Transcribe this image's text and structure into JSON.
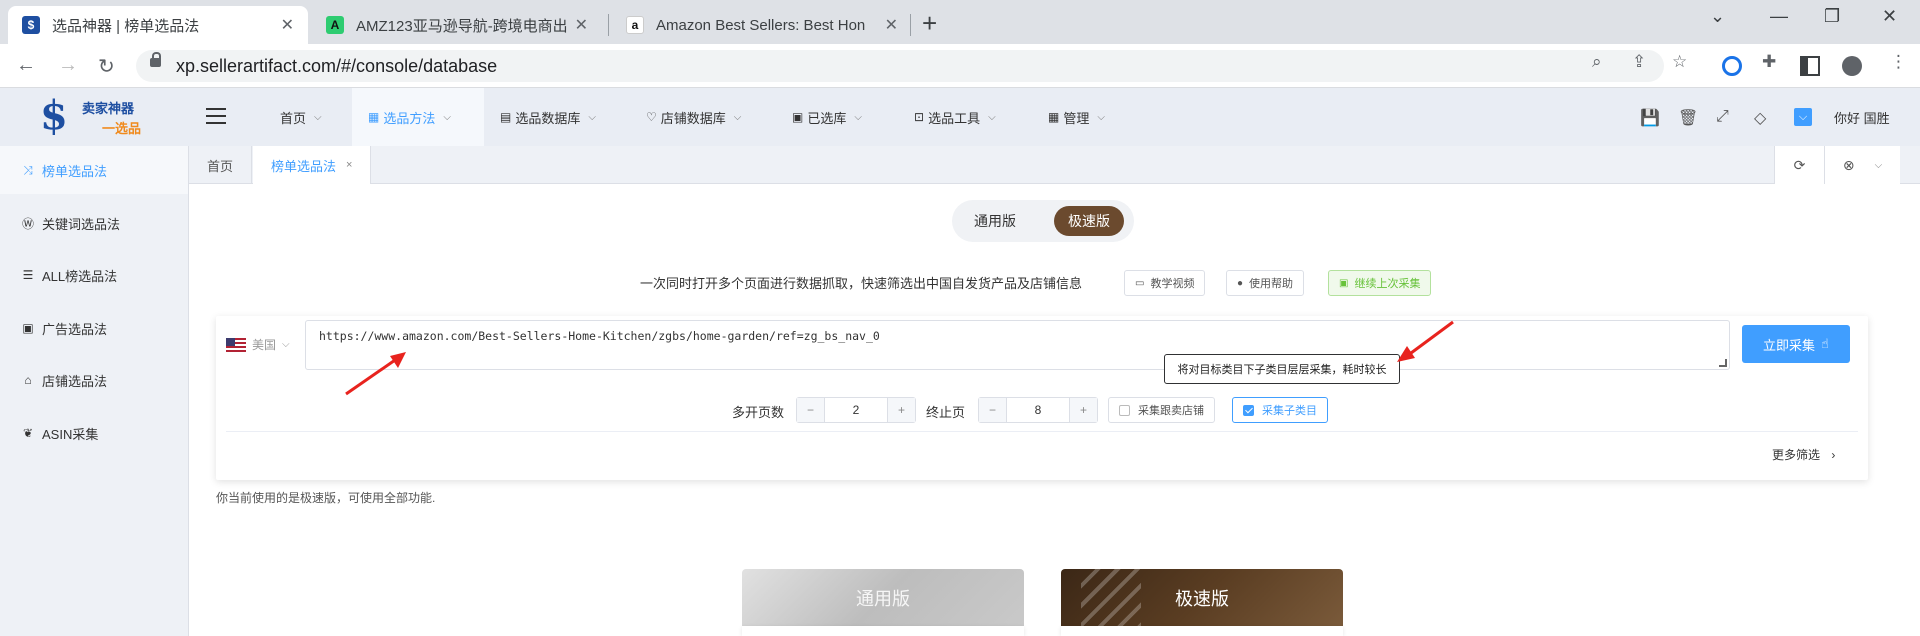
{
  "browser": {
    "tabs": [
      {
        "title": "选品神器 | 榜单选品法",
        "favicon": "sellerartifact-icon",
        "active": true
      },
      {
        "title": "AMZ123亚马逊导航-跨境电商出",
        "favicon": "amz123-icon",
        "active": false
      },
      {
        "title": "Amazon Best Sellers: Best Hon",
        "favicon": "amazon-icon",
        "active": false
      }
    ],
    "new_tab": "+",
    "url": "xp.sellerartifact.com/#/console/database"
  },
  "app": {
    "logo": {
      "line1": "卖家神器",
      "line2": "一选品"
    },
    "menu": [
      {
        "label": "首页",
        "icon": "",
        "active": false
      },
      {
        "label": "选品方法",
        "icon": "table-icon",
        "active": true
      },
      {
        "label": "选品数据库",
        "icon": "database-icon",
        "active": false
      },
      {
        "label": "店铺数据库",
        "icon": "heart-icon",
        "active": false
      },
      {
        "label": "已选库",
        "icon": "calendar-icon",
        "active": false
      },
      {
        "label": "选品工具",
        "icon": "tools-icon",
        "active": false
      },
      {
        "label": "管理",
        "icon": "grid-icon",
        "active": false
      }
    ],
    "greeting": "你好 国胜",
    "sidebar": [
      {
        "label": "榜单选品法",
        "icon": "shuffle-icon",
        "active": true
      },
      {
        "label": "关键词选品法",
        "icon": "wordpress-icon",
        "active": false
      },
      {
        "label": "ALL榜选品法",
        "icon": "list-icon",
        "active": false
      },
      {
        "label": "广告选品法",
        "icon": "ad-icon",
        "active": false
      },
      {
        "label": "店铺选品法",
        "icon": "shop-icon",
        "active": false
      },
      {
        "label": "ASIN采集",
        "icon": "leaf-icon",
        "active": false
      }
    ],
    "page_tabs": [
      {
        "label": "首页",
        "active": false
      },
      {
        "label": "榜单选品法",
        "active": true,
        "close": "×"
      }
    ]
  },
  "main": {
    "version_toggle": {
      "general": "通用版",
      "fast": "极速版",
      "selected": "极速版"
    },
    "description": "一次同时打开多个页面进行数据抓取，快速筛选出中国自发货产品及店铺信息",
    "buttons": {
      "tutorial": "教学视频",
      "help": "使用帮助",
      "continue": "继续上次采集"
    },
    "country": "美国",
    "url_value": "https://www.amazon.com/Best-Sellers-Home-Kitchen/zgbs/home-garden/ref=zg_bs_nav_0",
    "collect_button": "立即采集",
    "pages_label": "多开页数",
    "pages_value": "2",
    "end_page_label": "终止页",
    "end_page_value": "8",
    "follow_store_label": "采集跟卖店铺",
    "follow_store_checked": false,
    "subcategory_label": "采集子类目",
    "subcategory_checked": true,
    "tooltip": "将对目标类目下子类目层层采集，耗时较长",
    "more_filters": "更多筛选",
    "version_note": "你当前使用的是极速版，可使用全部功能.",
    "plans": {
      "general": "通用版",
      "fast": "极速版"
    }
  },
  "colors": {
    "accent": "#409eff",
    "brown": "#6b4a2e",
    "arrow": "#e8231e"
  }
}
